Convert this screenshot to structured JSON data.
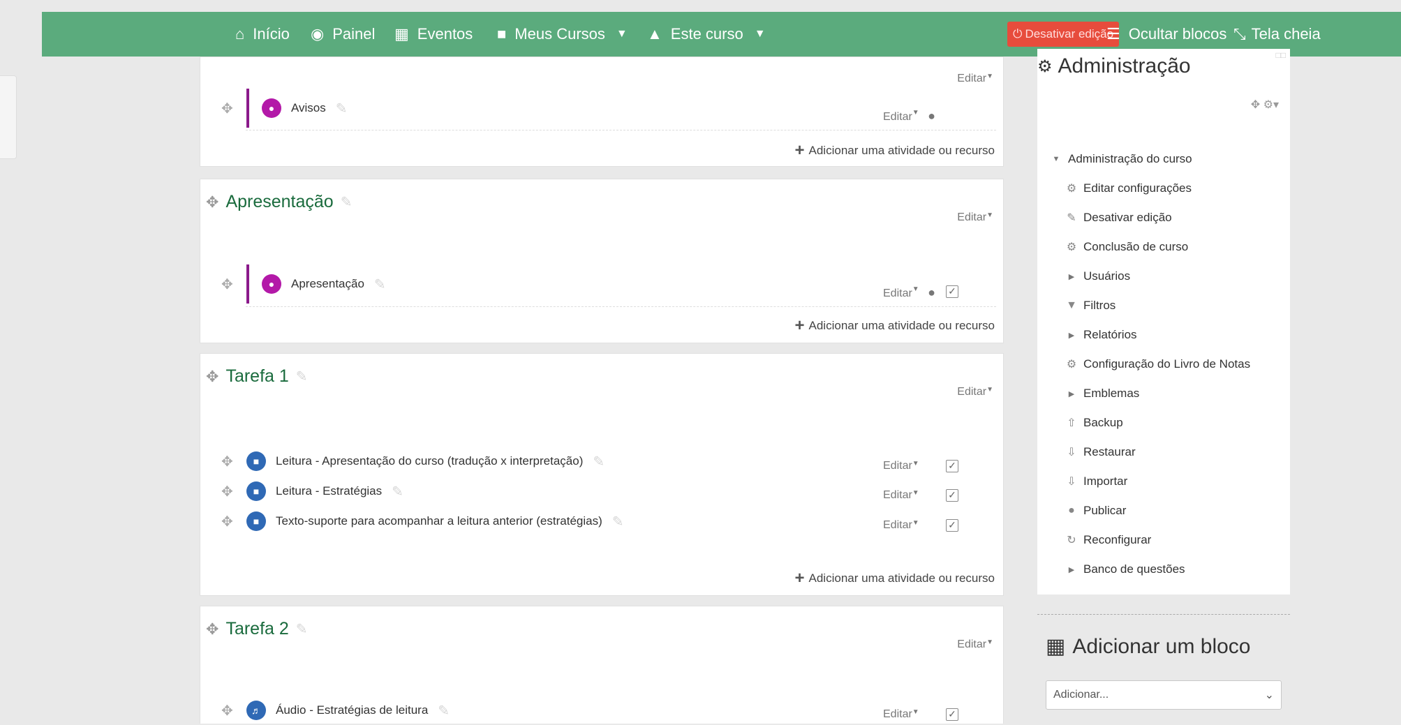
{
  "nav": {
    "home": "Início",
    "dashboard": "Painel",
    "events": "Eventos",
    "my_courses": "Meus Cursos",
    "this_course": "Este curso",
    "edit_off": "Desativar edição",
    "hide_blocks": "Ocultar blocos",
    "fullscreen": "Tela cheia"
  },
  "common": {
    "edit": "Editar",
    "add_activity": "Adicionar uma atividade ou recurso"
  },
  "sections": [
    {
      "title": "",
      "activities": [
        {
          "name": "Avisos",
          "type": "forum"
        }
      ]
    },
    {
      "title": "Apresentação",
      "activities": [
        {
          "name": "Apresentação",
          "type": "forum"
        }
      ]
    },
    {
      "title": "Tarefa 1",
      "activities": [
        {
          "name": "Leitura - Apresentação do curso (tradução x interpretação)",
          "type": "file"
        },
        {
          "name": "Leitura - Estratégias",
          "type": "file"
        },
        {
          "name": "Texto-suporte para acompanhar a leitura anterior (estratégias)",
          "type": "file"
        }
      ]
    },
    {
      "title": "Tarefa 2",
      "activities": [
        {
          "name": "Áudio - Estratégias de leitura",
          "type": "audio"
        }
      ]
    }
  ],
  "admin": {
    "title": "Administração",
    "course_admin": "Administração do curso",
    "items": [
      "Editar configurações",
      "Desativar edição",
      "Conclusão de curso",
      "Usuários",
      "Filtros",
      "Relatórios",
      "Configuração do Livro de Notas",
      "Emblemas",
      "Backup",
      "Restaurar",
      "Importar",
      "Publicar",
      "Reconfigurar",
      "Banco de questões"
    ]
  },
  "add_block": {
    "title": "Adicionar um bloco",
    "select_value": "Adicionar..."
  },
  "colors": {
    "navbar": "#5bab7d",
    "edit_off_button": "#e74c3c",
    "section_title": "#1a6b3d",
    "forum_icon": "#b319a8",
    "file_icon": "#2f69b5"
  }
}
